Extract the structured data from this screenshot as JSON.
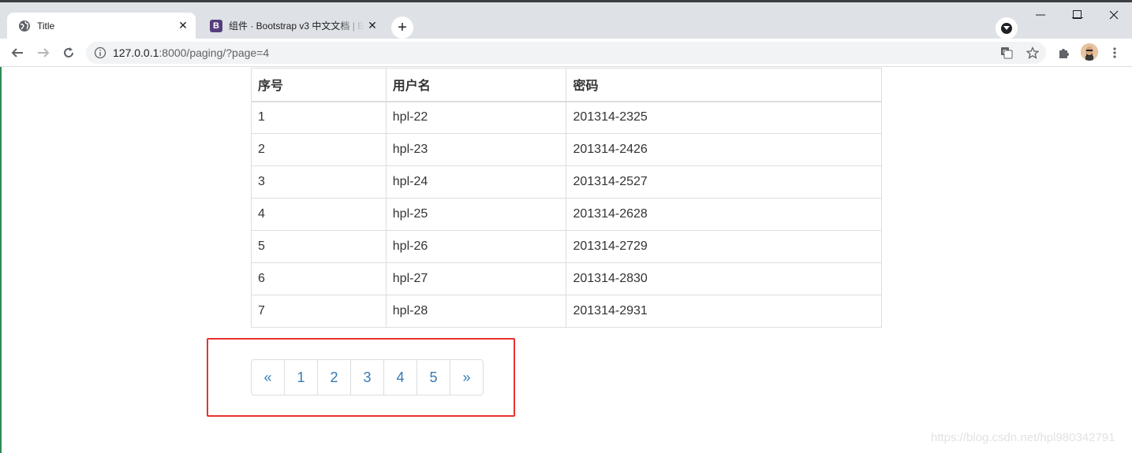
{
  "browser": {
    "tabs": [
      {
        "title": "Title",
        "favicon": "globe-icon",
        "active": true
      },
      {
        "title": "组件 · Bootstrap v3 中文文档 | B",
        "favicon": "bootstrap-icon",
        "favicon_letter": "B",
        "active": false
      }
    ],
    "new_tab_symbol": "+",
    "close_symbol": "✕",
    "window_controls": {
      "minimize": "—",
      "maximize": "☐",
      "close": "✕"
    },
    "address": {
      "host": "127.0.0.1",
      "path": ":8000/paging/?page=4"
    }
  },
  "table": {
    "headers": [
      "序号",
      "用户名",
      "密码"
    ],
    "rows": [
      [
        "1",
        "hpl-22",
        "201314-2325"
      ],
      [
        "2",
        "hpl-23",
        "201314-2426"
      ],
      [
        "3",
        "hpl-24",
        "201314-2527"
      ],
      [
        "4",
        "hpl-25",
        "201314-2628"
      ],
      [
        "5",
        "hpl-26",
        "201314-2729"
      ],
      [
        "6",
        "hpl-27",
        "201314-2830"
      ],
      [
        "7",
        "hpl-28",
        "201314-2931"
      ]
    ]
  },
  "pagination": {
    "prev": "«",
    "pages": [
      "1",
      "2",
      "3",
      "4",
      "5"
    ],
    "next": "»"
  },
  "watermark": "https://blog.csdn.net/hpl980342791",
  "colors": {
    "link": "#337ab7",
    "highlight_border": "#e8312f",
    "tab_bar": "#dee1e6",
    "bootstrap_purple": "#563d7c"
  }
}
